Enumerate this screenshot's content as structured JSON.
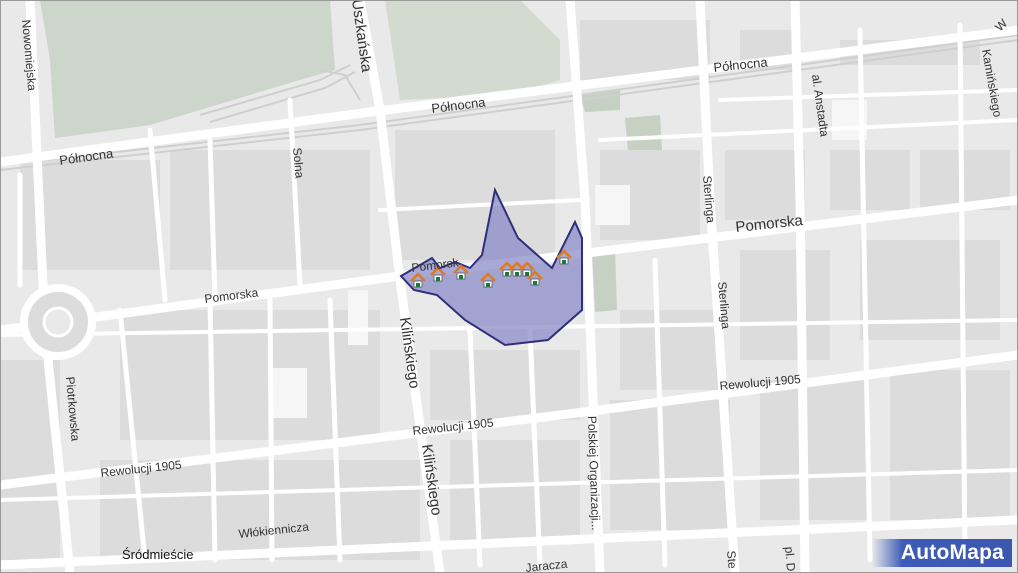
{
  "map": {
    "streets": {
      "polnocna_1": "Północna",
      "polnocna_2": "Północna",
      "polnocna_3": "Północna",
      "pomorska_1": "Pomorska",
      "pomorska_2": "Pomorska",
      "rewolucji_1": "Rewolucji 1905",
      "rewolucji_2": "Rewolucji 1905",
      "rewolucji_3": "Rewolucji 1905",
      "kilinskiego_1": "Kilińskiego",
      "kilinskiego_2": "Kilińskiego",
      "sterlinga_1": "Sterlinga",
      "sterlinga_2": "Sterlinga",
      "sterlinga_3": "Ste",
      "solna": "Solna",
      "nowomiejska": "Nowomiejska",
      "piotrkowska": "Piotrkowska",
      "wlokiennicza": "Włókiennicza",
      "jaracza": "Jaracza",
      "polskiej": "Polskiej Organizacji...",
      "anstadta": "al. Anstadta",
      "kaminskiego": "Kamińskiego",
      "wschodnia": "Wschodnia",
      "plac": "pl. D",
      "pomorska_clip": "Pomorsk"
    },
    "district": "Śródmieście",
    "logo": "AutoMapa",
    "colors": {
      "background": "#e9e9e9",
      "road": "#ffffff",
      "park": "#c9d3c5",
      "area_fill": "#8585c6",
      "area_stroke": "#2f2f7a",
      "marker_roof": "#e07a1e"
    },
    "markers": 12
  }
}
